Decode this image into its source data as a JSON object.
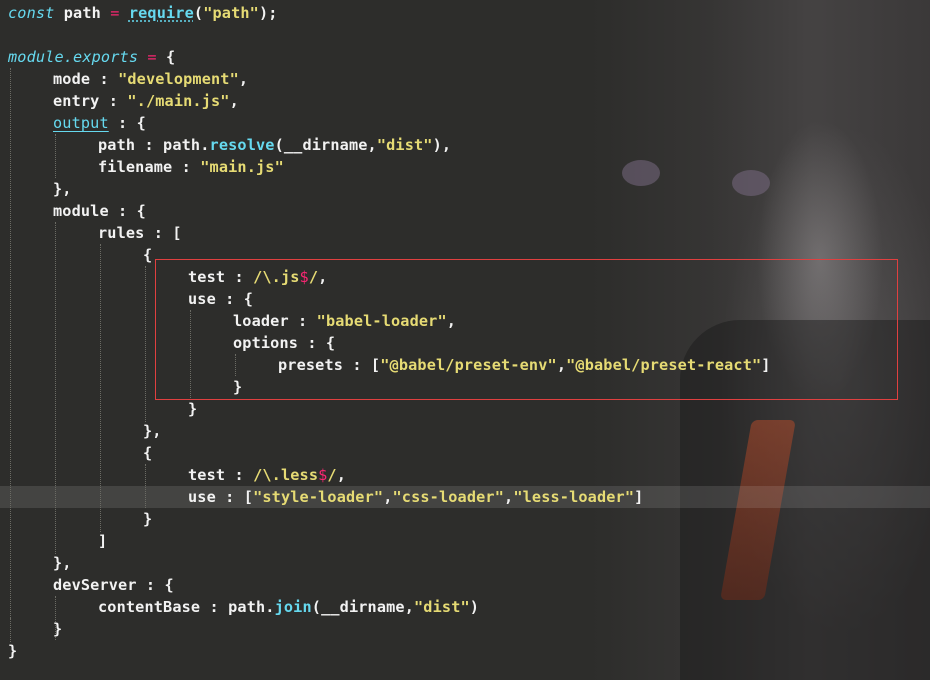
{
  "colors": {
    "background": "#2d2d2b",
    "keyword": "#66d9ef",
    "operator": "#f92672",
    "string": "#e6db74",
    "text": "#f2f2f2",
    "selection_box": "#e04040"
  },
  "code": {
    "l1": {
      "kw": "const",
      "t1": " path ",
      "op": "=",
      "t2": " ",
      "fn": "require",
      "t3": "(",
      "s1": "\"path\"",
      "t4": ");"
    },
    "l3": {
      "kw": "module.exports",
      "t1": " ",
      "op": "=",
      "t2": " {"
    },
    "l4": {
      "t1": "mode : ",
      "s1": "\"development\"",
      "t2": ","
    },
    "l5": {
      "t1": "entry : ",
      "s1": "\"./main.js\"",
      "t2": ","
    },
    "l6": {
      "k1": "output",
      "t1": " : {"
    },
    "l7": {
      "t1": "path : path.",
      "fn": "resolve",
      "t2": "(__dirname,",
      "s1": "\"dist\"",
      "t3": "),"
    },
    "l8": {
      "t1": "filename : ",
      "s1": "\"main.js\""
    },
    "l9": {
      "t1": "},"
    },
    "l10": {
      "t1": "module : {"
    },
    "l11": {
      "t1": "rules : ["
    },
    "l12": {
      "t1": "{"
    },
    "l13": {
      "t1": "test : ",
      "s1": "/\\.js",
      "op": "$",
      "s2": "/",
      "t2": ","
    },
    "l14": {
      "t1": "use : {"
    },
    "l15": {
      "t1": "loader : ",
      "s1": "\"babel-loader\"",
      "t2": ","
    },
    "l16": {
      "t1": "options : {"
    },
    "l17": {
      "t1": "presets : [",
      "s1": "\"@babel/preset-env\"",
      "t2": ",",
      "s2": "\"@babel/preset-react\"",
      "t3": "]"
    },
    "l18": {
      "t1": "}"
    },
    "l19": {
      "t1": "}"
    },
    "l20": {
      "t1": "},"
    },
    "l21": {
      "t1": "{"
    },
    "l22": {
      "t1": "test : ",
      "s1": "/\\.less",
      "op": "$",
      "s2": "/",
      "t2": ","
    },
    "l23": {
      "t1": "use : [",
      "s1": "\"style-loader\"",
      "t2": ",",
      "s2": "\"css-loader\"",
      "t3": ",",
      "s3": "\"less-loader\"",
      "t4": "]"
    },
    "l24": {
      "t1": "}"
    },
    "l25": {
      "t1": "]"
    },
    "l26": {
      "t1": "},"
    },
    "l27": {
      "t1": "devServer : {"
    },
    "l28": {
      "t1": "contentBase : path.",
      "fn": "join",
      "t2": "(__dirname,",
      "s1": "\"dist\"",
      "t3": ")"
    },
    "l29": {
      "t1": "}"
    },
    "l30": {
      "t1": "}"
    }
  }
}
